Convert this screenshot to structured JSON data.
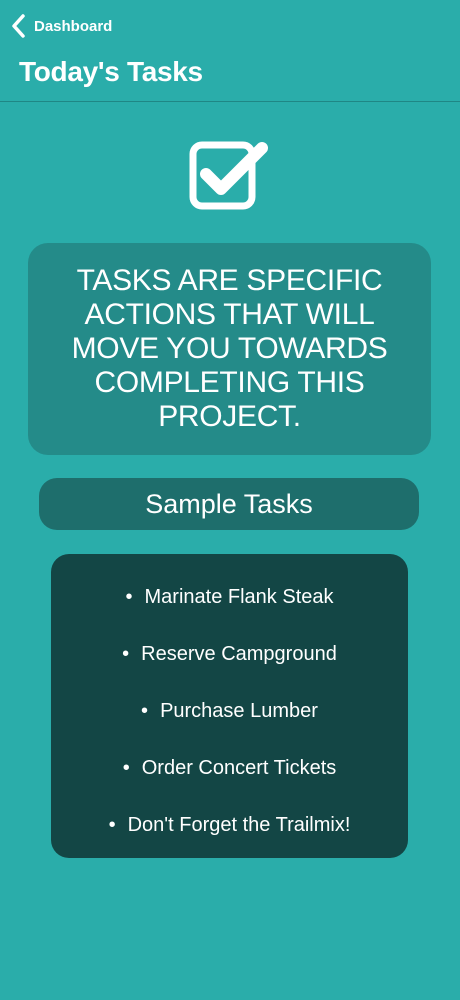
{
  "nav": {
    "back_label": "Dashboard",
    "back_icon": "chevron-left-icon",
    "title": "Today's Tasks"
  },
  "hero_icon": "checkbox-checked-icon",
  "info_card": {
    "text": "TASKS ARE SPECIFIC ACTIONS THAT WILL MOVE YOU TOWARDS COMPLETING THIS PROJECT."
  },
  "sample_section": {
    "header": "Sample Tasks",
    "tasks": [
      "Marinate Flank Steak",
      "Reserve Campground",
      "Purchase Lumber",
      "Order Concert Tickets",
      "Don't Forget the Trailmix!"
    ]
  },
  "colors": {
    "background": "#2aadaa",
    "info_card": "#248b89",
    "sample_header": "#1e6e6c",
    "task_card": "#134645",
    "text": "#ffffff"
  }
}
